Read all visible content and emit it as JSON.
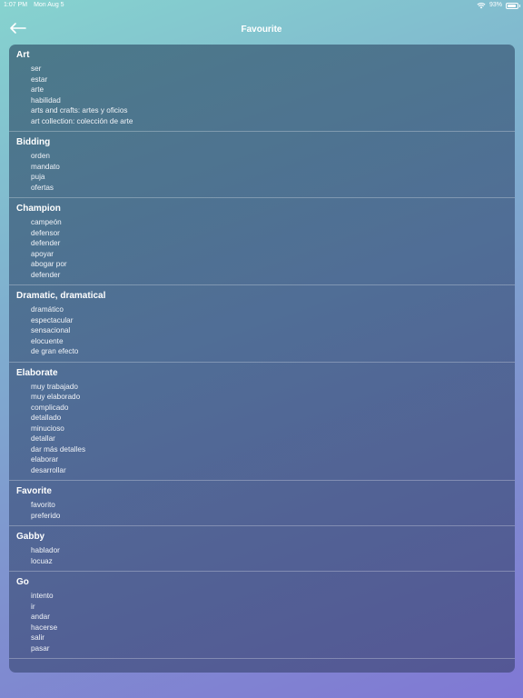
{
  "status_bar": {
    "time": "1:07 PM",
    "date": "Mon Aug 5",
    "battery_percent": "93%",
    "battery_level": 0.93
  },
  "nav": {
    "title": "Favourite",
    "back_icon": "arrow-left-icon"
  },
  "sections": [
    {
      "title": "Art",
      "items": [
        "ser",
        "estar",
        "arte",
        "habilidad",
        "arts and crafts: artes y oficios",
        "art collection: colección de arte"
      ]
    },
    {
      "title": "Bidding",
      "items": [
        "orden",
        "mandato",
        "puja",
        "ofertas"
      ]
    },
    {
      "title": "Champion",
      "items": [
        "campeón",
        "defensor",
        "defender",
        "apoyar",
        "abogar por",
        "defender"
      ]
    },
    {
      "title": "Dramatic, dramatical",
      "items": [
        "dramático",
        "espectacular",
        "sensacional",
        "elocuente",
        "de gran efecto"
      ]
    },
    {
      "title": "Elaborate",
      "items": [
        "muy trabajado",
        "muy elaborado",
        "complicado",
        "detallado",
        "minucioso",
        "detallar",
        "dar más detalles",
        "elaborar",
        "desarrollar"
      ]
    },
    {
      "title": "Favorite",
      "items": [
        "favorito",
        "preferido"
      ]
    },
    {
      "title": "Gabby",
      "items": [
        "hablador",
        "locuaz"
      ]
    },
    {
      "title": "Go",
      "items": [
        "intento",
        "ir",
        "andar",
        "hacerse",
        "salir",
        "pasar"
      ]
    }
  ]
}
